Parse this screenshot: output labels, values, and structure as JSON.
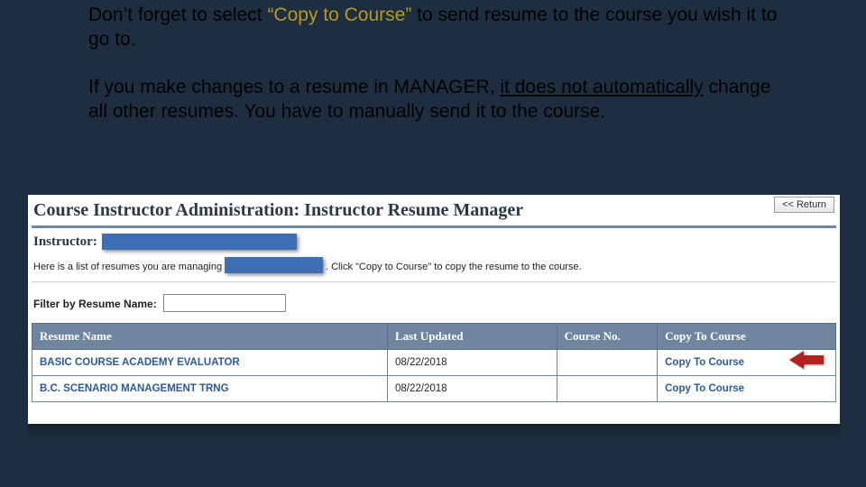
{
  "intro": {
    "line1a": "Don’t forget to select ",
    "highlight": "“Copy to Course”",
    "line1b": " to send resume to the course you wish it to go to.",
    "line2a": "If you make changes to a resume in MANAGER, ",
    "underline": "it does not automatically",
    "line2b": " change all other resumes.  You have to manually send it to the course."
  },
  "panel": {
    "title": "Course Instructor Administration: Instructor Resume Manager",
    "return_label": "<< Return",
    "instructor_label": "Instructor:",
    "desc_lead": "Here is a list of resumes you are managing for",
    "desc_tail": ". Click \"Copy to Course\" to copy the resume to the course.",
    "filter_label": "Filter by Resume Name:",
    "filter_value": ""
  },
  "table": {
    "headers": {
      "name": "Resume Name",
      "updated": "Last Updated",
      "course": "Course No.",
      "copy": "Copy To Course"
    },
    "rows": [
      {
        "name": "BASIC COURSE ACADEMY EVALUATOR",
        "updated": "08/22/2018",
        "course": "",
        "copy": "Copy To Course"
      },
      {
        "name": "B.C. SCENARIO MANAGEMENT TRNG",
        "updated": "08/22/2018",
        "course": "",
        "copy": "Copy To Course"
      }
    ]
  }
}
